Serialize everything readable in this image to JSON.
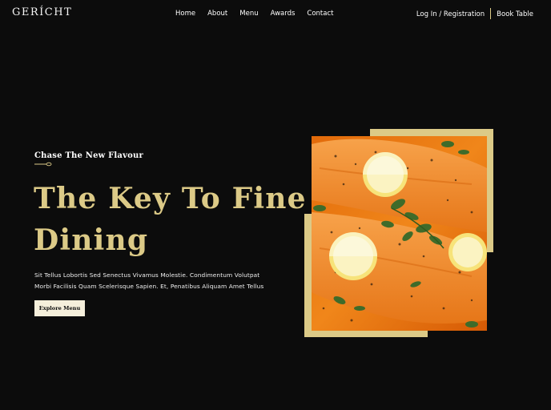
{
  "navbar": {
    "logo": "GERÍCHT",
    "links": [
      "Home",
      "About",
      "Menu",
      "Awards",
      "Contact"
    ],
    "login": "Log In / Registration",
    "book_table": "Book Table"
  },
  "hero": {
    "subtitle": "Chase The New Flavour",
    "headline_line1": "The Key To Fine",
    "headline_line2": "Dining",
    "description": "Sit Tellus Lobortis Sed Senectus Vivamus Molestie. Condimentum Volutpat Morbi Facilisis Quam Scelerisque Sapien. Et, Penatibus Aliquam Amet Tellus",
    "button": "Explore Menu"
  },
  "colors": {
    "background": "#0c0c0c",
    "accent_gold": "#dcca87",
    "button_bg": "#f5efdb"
  },
  "icons": {
    "spoon": "spoon-icon"
  }
}
